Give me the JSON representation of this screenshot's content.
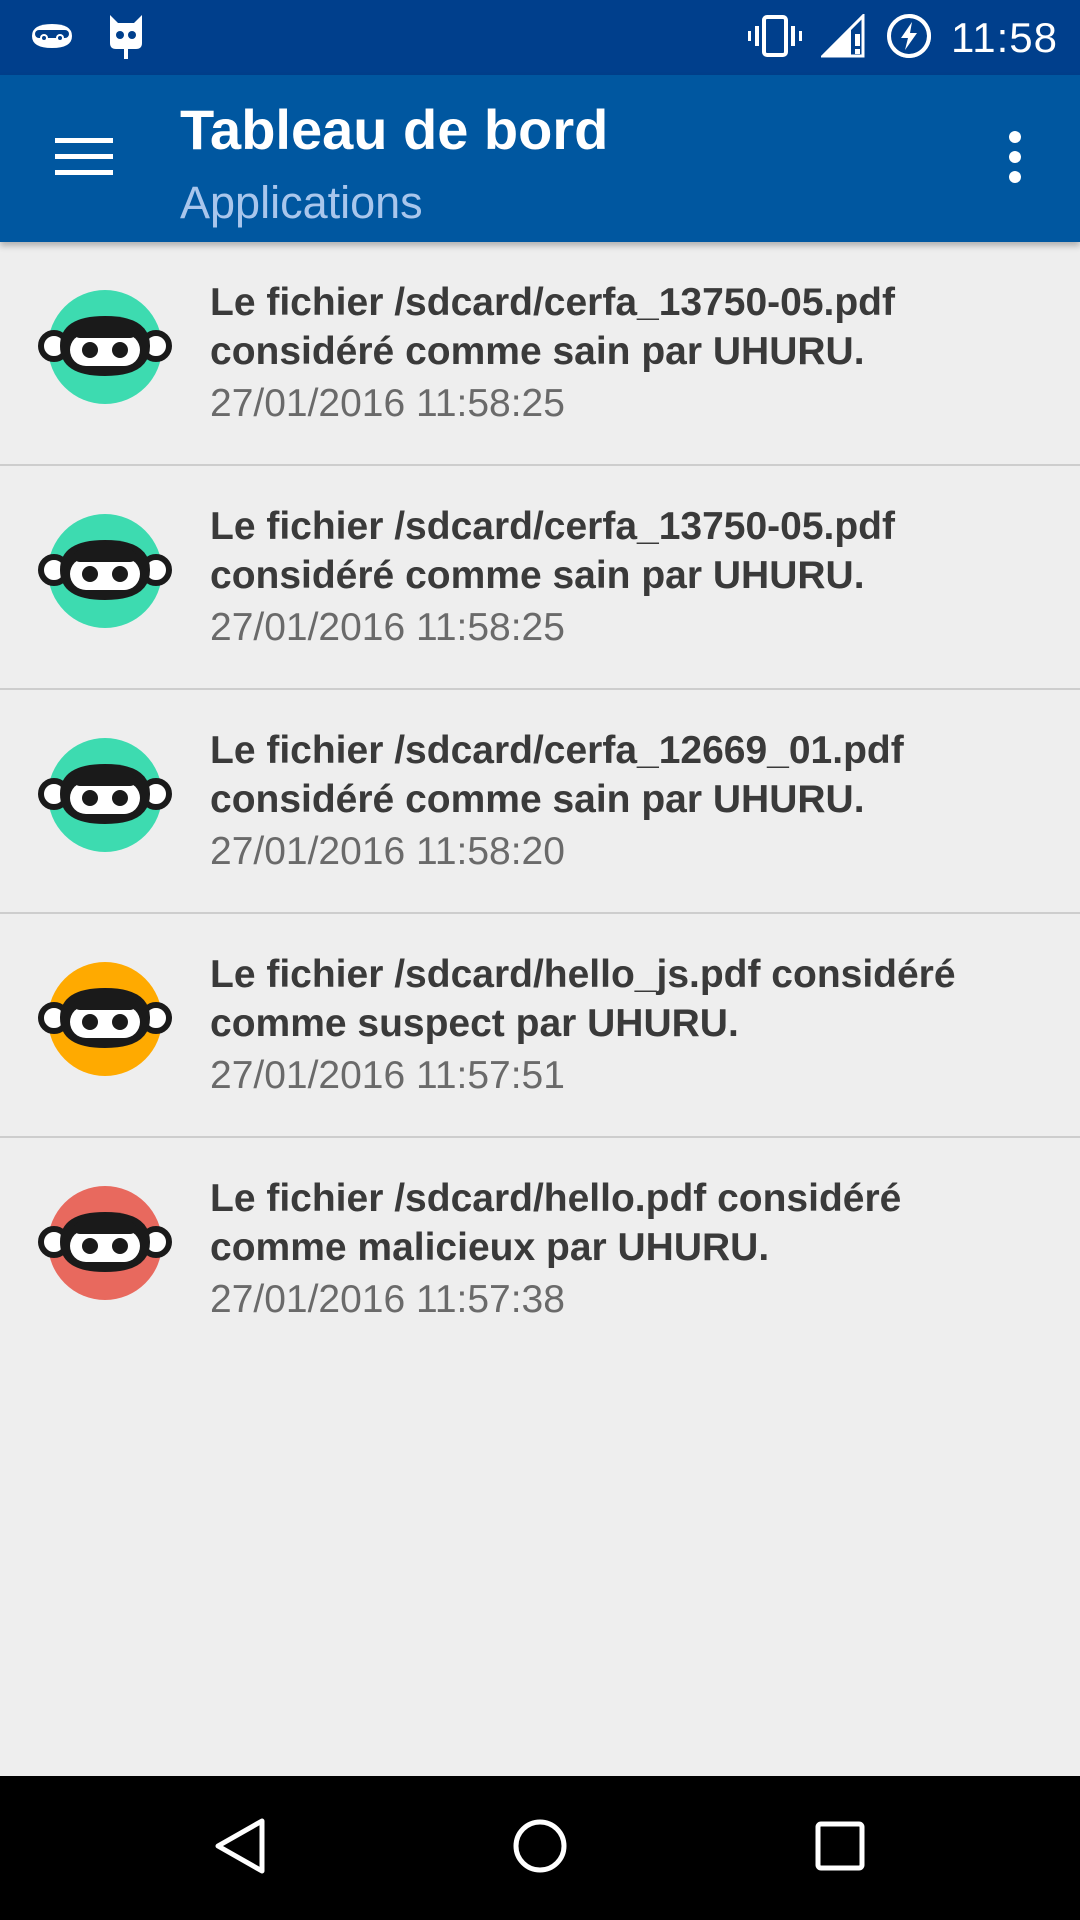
{
  "status_bar": {
    "time": "11:58",
    "left_icons": [
      "uhuru-notification-icon",
      "cyanogen-icon"
    ],
    "right_icons": [
      "vibrate-icon",
      "signal-icon",
      "battery-charging-icon"
    ]
  },
  "app_bar": {
    "title": "Tableau de bord",
    "subtitle": "Applications",
    "colors": {
      "status_bar": "#003F8C",
      "app_bar": "#0057A0"
    }
  },
  "status_colors": {
    "sain": "#3DDBB0",
    "suspect": "#FFAA00",
    "malicieux": "#E8695E"
  },
  "items": [
    {
      "message": "Le fichier /sdcard/cerfa_13750-05.pdf considéré comme sain par UHURU.",
      "timestamp": "27/01/2016 11:58:25",
      "status": "sain",
      "color": "#3DDBB0"
    },
    {
      "message": "Le fichier /sdcard/cerfa_13750-05.pdf considéré comme sain par UHURU.",
      "timestamp": "27/01/2016 11:58:25",
      "status": "sain",
      "color": "#3DDBB0"
    },
    {
      "message": "Le fichier /sdcard/cerfa_12669_01.pdf considéré comme sain par UHURU.",
      "timestamp": "27/01/2016 11:58:20",
      "status": "sain",
      "color": "#3DDBB0"
    },
    {
      "message": "Le fichier /sdcard/hello_js.pdf considéré comme suspect par UHURU.",
      "timestamp": "27/01/2016 11:57:51",
      "status": "suspect",
      "color": "#FFAA00"
    },
    {
      "message": "Le fichier /sdcard/hello.pdf considéré comme malicieux par UHURU.",
      "timestamp": "27/01/2016 11:57:38",
      "status": "malicieux",
      "color": "#E8695E"
    }
  ],
  "nav_bar": {
    "buttons": [
      "back-icon",
      "home-icon",
      "recents-icon"
    ]
  }
}
